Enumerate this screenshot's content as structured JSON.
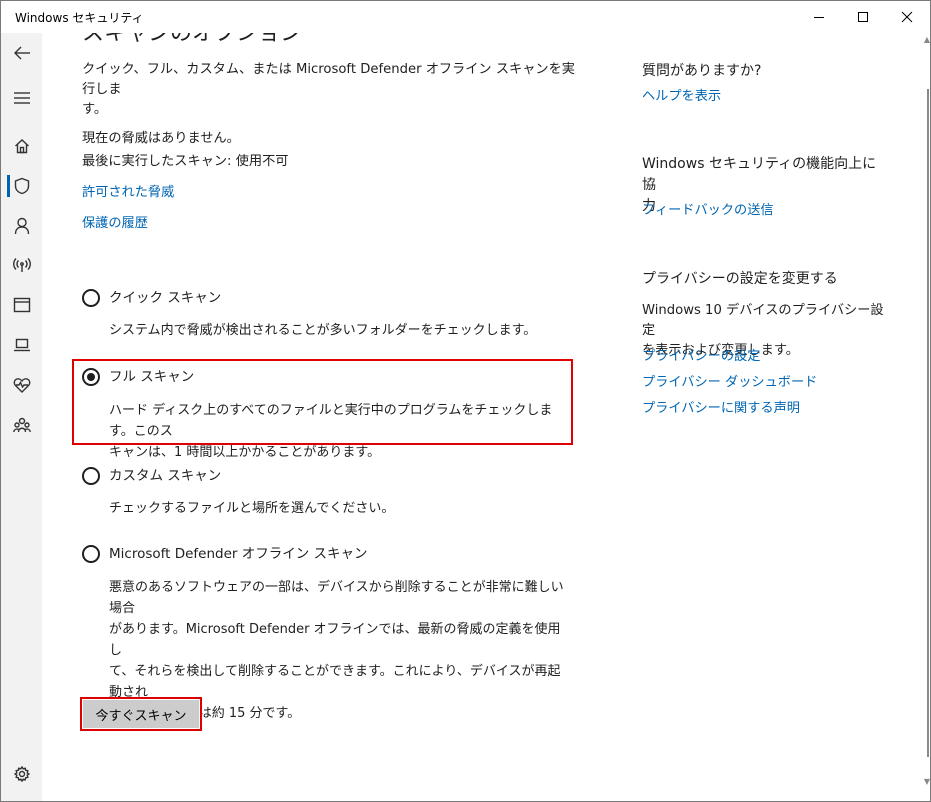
{
  "window": {
    "title": "Windows セキュリティ"
  },
  "sidebar": {
    "items": [
      {
        "icon": "back-arrow-icon"
      },
      {
        "icon": "hamburger-menu-icon"
      },
      {
        "icon": "home-icon"
      },
      {
        "icon": "shield-icon",
        "active": true
      },
      {
        "icon": "person-icon"
      },
      {
        "icon": "wireless-antenna-icon"
      },
      {
        "icon": "app-browser-icon"
      },
      {
        "icon": "laptop-icon"
      },
      {
        "icon": "heart-pulse-icon"
      },
      {
        "icon": "family-icon"
      },
      {
        "icon": "gear-icon"
      }
    ]
  },
  "main": {
    "heading_clipped": "スキャンのオプション",
    "intro": "クイック、フル、カスタム、または Microsoft Defender オフライン スキャンを実行しま\nす。",
    "status_line1": "現在の脅威はありません。",
    "status_line2": "最後に実行したスキャン: 使用不可",
    "link_allowed": "許可された脅威",
    "link_history": "保護の履歴",
    "options": [
      {
        "label": "クイック スキャン",
        "desc": "システム内で脅威が検出されることが多いフォルダーをチェックします。",
        "selected": false
      },
      {
        "label": "フル スキャン",
        "desc": "ハード ディスク上のすべてのファイルと実行中のプログラムをチェックします。このス\nキャンは、1 時間以上かかることがあります。",
        "selected": true
      },
      {
        "label": "カスタム スキャン",
        "desc": "チェックするファイルと場所を選んでください。",
        "selected": false
      },
      {
        "label": "Microsoft Defender オフライン スキャン",
        "desc": "悪意のあるソフトウェアの一部は、デバイスから削除することが非常に難しい場合\nがあります。Microsoft Defender オフラインでは、最新の脅威の定義を使用し\nて、それらを検出して削除することができます。これにより、デバイスが再起動され\nます。所要時間は約 15 分です。",
        "selected": false
      }
    ],
    "scan_button": "今すぐスキャン"
  },
  "right": {
    "q_title": "質問がありますか?",
    "q_link": "ヘルプを表示",
    "improve_title": "Windows セキュリティの機能向上に協\n力",
    "improve_link": "フィードバックの送信",
    "privacy_title": "プライバシーの設定を変更する",
    "privacy_desc": "Windows 10 デバイスのプライバシー設定\nを表示および変更します。",
    "privacy_links": [
      "プライバシーの設定",
      "プライバシー ダッシュボード",
      "プライバシーに関する声明"
    ]
  },
  "colors": {
    "link": "#0066b4",
    "highlight": "#e00000",
    "active_indicator": "#0063b1",
    "sidebar_bg": "#f2f2f2"
  }
}
